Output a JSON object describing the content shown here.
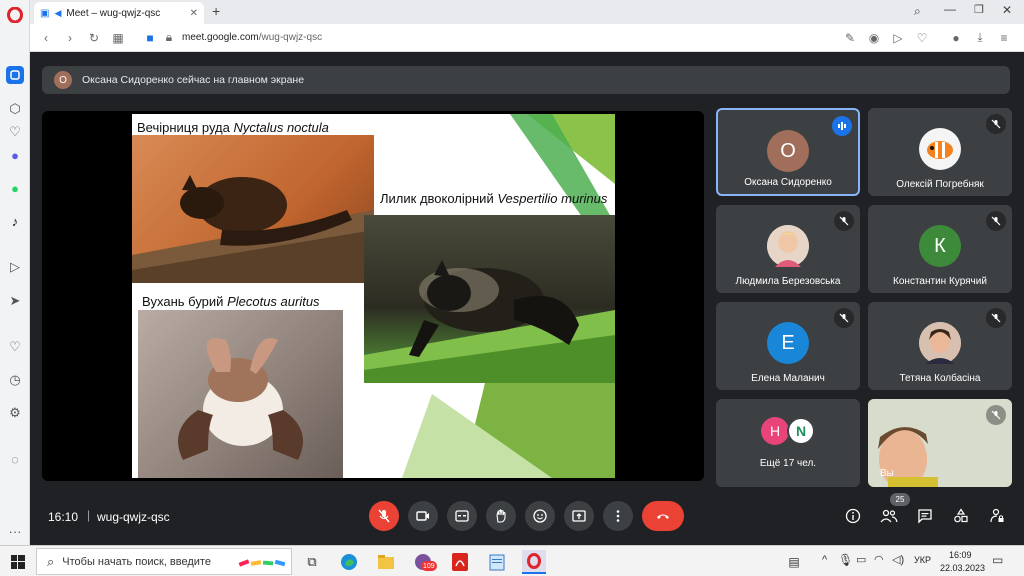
{
  "browser": {
    "tab_title": "Meet – wug-qwjz-qsc",
    "new_tab": "+",
    "url_host": "meet.google.com",
    "url_path": "/wug-qwjz-qsc"
  },
  "banner": {
    "avatar_letter": "О",
    "text": "Оксана Сидоренко сейчас на главном экране"
  },
  "slide": {
    "cap1_plain": "Вечірниця руда ",
    "cap1_latin": "Nyctalus noctula",
    "cap2_plain": "Лилик двоколірний ",
    "cap2_latin": "Vespertilio murinus",
    "cap3_plain": "Вухань бурий ",
    "cap3_latin": "Plecotus auritus"
  },
  "participants": [
    {
      "name": "Оксана Сидоренко",
      "letter": "О",
      "color": "#a06e5a"
    },
    {
      "name": "Олексій Погребняк",
      "letter": "",
      "color": "#f5f5f5"
    },
    {
      "name": "Людмила Березовська",
      "letter": "",
      "color": "#d9c3b5"
    },
    {
      "name": "Константин Курячий",
      "letter": "К",
      "color": "#3c8a3a"
    },
    {
      "name": "Елена Маланич",
      "letter": "Е",
      "color": "#1a86d8"
    },
    {
      "name": "Тетяна Колбасіна",
      "letter": "",
      "color": "#c9a58a"
    },
    {
      "name": "Ещё 17 чел.",
      "letter1": "Н",
      "letter2": "N"
    },
    {
      "name": "Вы"
    }
  ],
  "controls": {
    "time": "16:10",
    "meeting_code": "wug-qwjz-qsc",
    "people_count": "25"
  },
  "taskbar": {
    "search_placeholder": "Чтобы начать поиск, введите",
    "lang": "УКР",
    "clock_time": "16:09",
    "clock_date": "22.03.2023",
    "badge": "109"
  }
}
